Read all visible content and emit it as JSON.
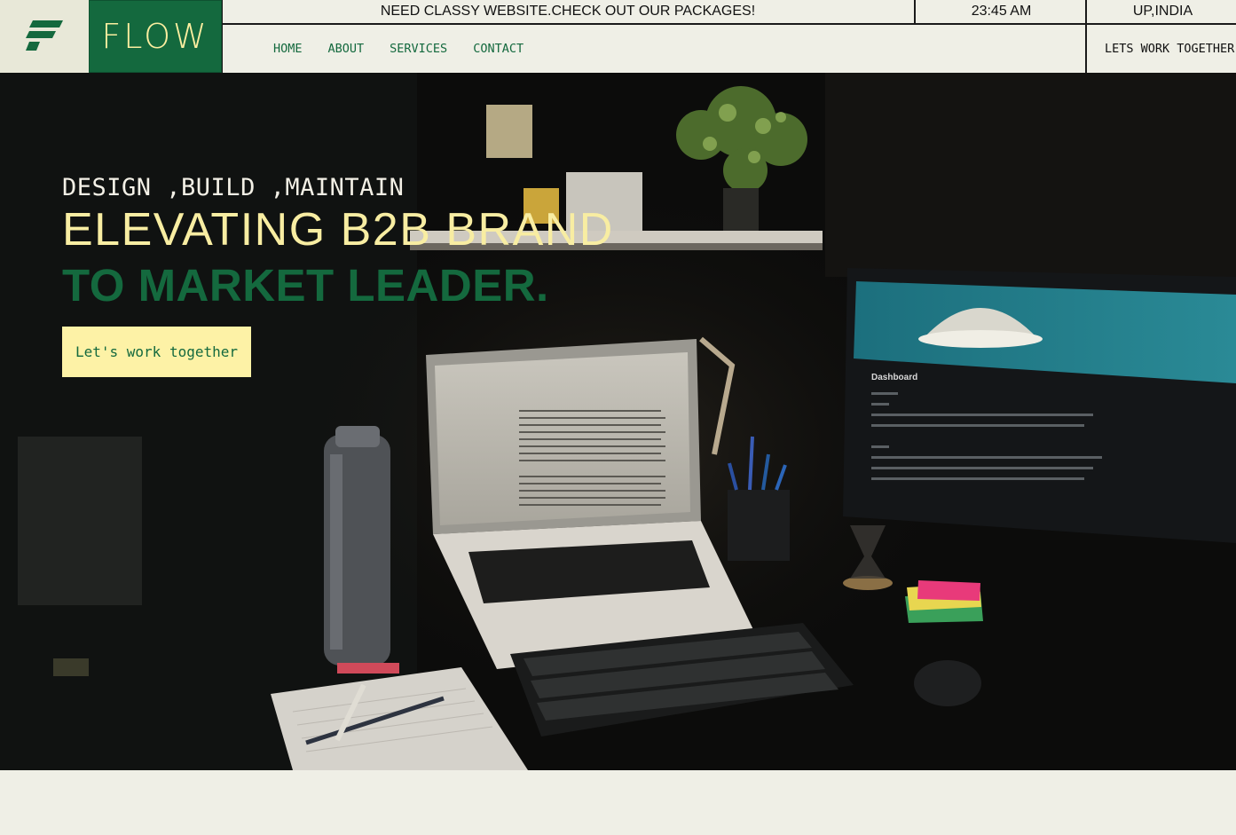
{
  "brand": {
    "logo_icon": "flow-f-logo-icon",
    "name": "FLOW"
  },
  "topbar": {
    "promo": "NEED CLASSY WEBSITE.CHECK OUT OUR PACKAGES!",
    "time": "23:45 AM",
    "location": "UP,INDIA"
  },
  "nav": {
    "items": [
      "HOME",
      "ABOUT",
      "SERVICES",
      "CONTACT"
    ],
    "cta": "LETS WORK TOGETHER"
  },
  "hero": {
    "subtitle": "DESIGN ,BUILD ,MAINTAIN",
    "title_line1": "ELEVATING B2B BRAND",
    "title_line2": "TO MARKET LEADER.",
    "button": "Let's work together",
    "background": "desk-workspace-photo",
    "monitor_text": "Dashboard"
  },
  "colors": {
    "primary_green": "#14693e",
    "accent_yellow": "#fdf2a6",
    "background": "#efefe6",
    "hero_dark": "#0b0b0a"
  }
}
